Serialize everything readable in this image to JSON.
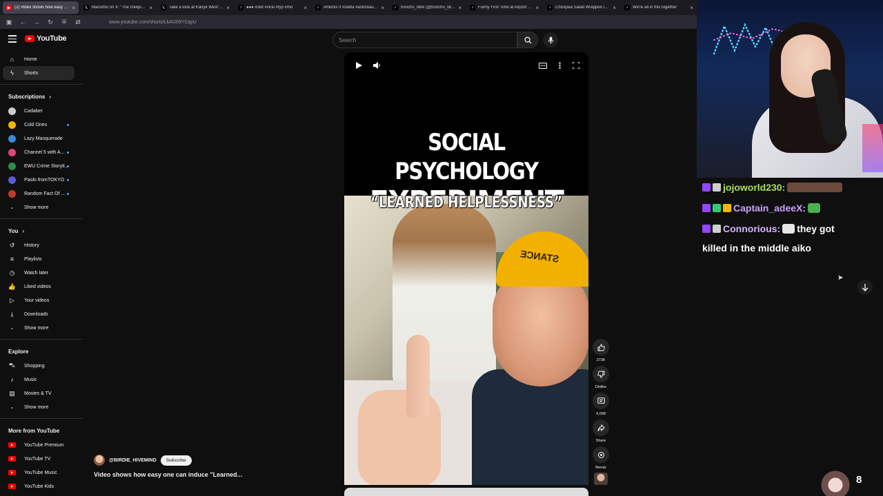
{
  "browser": {
    "tabs": [
      {
        "title": "(2) Video shows how easy one",
        "active": true,
        "icon": "youtube-icon",
        "color": "#ff0000"
      },
      {
        "title": "Massimo on X: \"The creepiest t",
        "icon": "x-icon",
        "color": "#000000"
      },
      {
        "title": "Take a look at Kanye West's lat",
        "icon": "x-icon",
        "color": "#000000"
      },
      {
        "title": "●●● #skit #viral #fyp #mo",
        "icon": "tiktok-icon",
        "color": "#000000"
      },
      {
        "title": "Artemis II #Delta #astronauts #",
        "icon": "tiktok-icon",
        "color": "#000000"
      },
      {
        "title": "honcho_libre (@honcho_libre) ·",
        "icon": "tiktok-icon",
        "color": "#000000"
      },
      {
        "title": "Funny First Time at Airport Mo",
        "icon": "tiktok-icon",
        "color": "#000000"
      },
      {
        "title": "Chickpea Salad Wrapped in Pe",
        "icon": "tiktok-icon",
        "color": "#000000"
      },
      {
        "title": "We're all in this together",
        "icon": "tiktok-icon",
        "color": "#000000"
      }
    ],
    "url": "www.youtube.com/shorts/LkAU09YCqyU"
  },
  "youtube": {
    "logo_text": "YouTube",
    "search_placeholder": "Search",
    "sidebar": {
      "main": [
        {
          "label": "Home",
          "icon": "home-icon"
        },
        {
          "label": "Shorts",
          "icon": "shorts-icon",
          "active": true
        }
      ],
      "subscriptions_title": "Subscriptions",
      "subscriptions": [
        {
          "label": "Cadaber",
          "color": "#cccccc",
          "dot": false
        },
        {
          "label": "Cold Ones",
          "color": "#f2b705",
          "dot": true
        },
        {
          "label": "Lazy Masquerade",
          "color": "#3b8ad9",
          "dot": false
        },
        {
          "label": "Channel 5 with A...",
          "color": "#e0457b",
          "dot": true
        },
        {
          "label": "EWU Crime Storyti...",
          "color": "#2f8c4c",
          "dot": true
        },
        {
          "label": "Paolo fromTOKYO",
          "color": "#5a5ad6",
          "dot": true
        },
        {
          "label": "Random Fact Of ...",
          "color": "#c0392b",
          "dot": true
        }
      ],
      "show_more": "Show more",
      "you_title": "You",
      "you_items": [
        {
          "label": "History",
          "icon": "history-icon"
        },
        {
          "label": "Playlists",
          "icon": "playlists-icon"
        },
        {
          "label": "Watch later",
          "icon": "clock-icon"
        },
        {
          "label": "Liked videos",
          "icon": "thumbs-up-icon"
        },
        {
          "label": "Your videos",
          "icon": "video-icon"
        },
        {
          "label": "Downloads",
          "icon": "download-icon"
        }
      ],
      "explore_title": "Explore",
      "explore_items": [
        {
          "label": "Shopping",
          "icon": "shopping-bag-icon"
        },
        {
          "label": "Music",
          "icon": "music-note-icon"
        },
        {
          "label": "Movies & TV",
          "icon": "film-icon"
        }
      ],
      "more_title": "More from YouTube",
      "more_items": [
        {
          "label": "YouTube Premium"
        },
        {
          "label": "YouTube TV"
        },
        {
          "label": "YouTube Music"
        },
        {
          "label": "YouTube Kids"
        }
      ]
    },
    "short": {
      "title_line1": "SOCIAL PSYCHOLOGY",
      "title_line2": "EXPERIMENT",
      "subtitle": "“LEARNED HELPLESSNESS”",
      "cap_text": "STANCE"
    },
    "actions": {
      "likes": "273K",
      "dislike_label": "Dislike",
      "comments": "4,098",
      "share_label": "Share",
      "remix_label": "Remix"
    },
    "channel": {
      "handle": "@BIRDIE_HIVEMIND",
      "subscribe_label": "Subscribe",
      "caption": "Video shows how easy one can induce \"Learned..."
    }
  },
  "chat": {
    "messages": [
      {
        "user": "jojoworld230:",
        "user_color": "#a8e05f",
        "text": ""
      },
      {
        "user": "Captain_adeeX:",
        "user_color": "#c9a2ff",
        "text": ""
      },
      {
        "user": "Connorious:",
        "user_color": "#d7b6ff",
        "text": "they got"
      }
    ],
    "wrap_text": "killed in the middle aiko",
    "viewer_count": "8"
  }
}
